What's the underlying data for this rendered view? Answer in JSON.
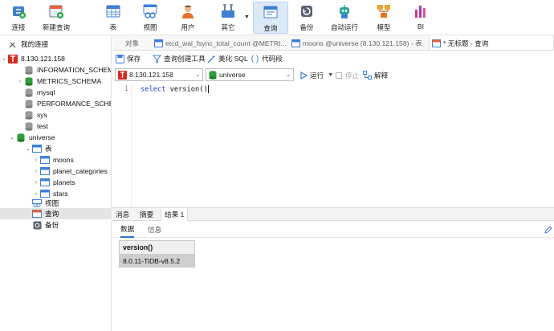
{
  "toolbar": {
    "connect": "连接",
    "new_query": "新建查询",
    "table": "表",
    "view": "视图",
    "user": "用户",
    "other": "其它",
    "query": "查询",
    "backup": "备份",
    "automation": "自动运行",
    "model": "模型",
    "bi": "BI"
  },
  "sidebar": {
    "my_connections": "我的连接",
    "connection": "8.130.121.158",
    "databases": [
      "INFORMATION_SCHEMA",
      "METRICS_SCHEMA",
      "mysql",
      "PERFORMANCE_SCHEMA",
      "sys",
      "test"
    ],
    "active_db": "universe",
    "tables_folder": "表",
    "tables": [
      "moons",
      "planet_categories",
      "planets",
      "stars"
    ],
    "views": "视图",
    "queries": "查询",
    "backups": "备份"
  },
  "tabs": {
    "objects": "对象",
    "tab1": "etcd_wal_fsync_total_count @METRI...",
    "tab2": "moons @universe (8.130.121.158) - 表",
    "tab3": "* 无标题 - 查询"
  },
  "query_toolbar": {
    "save": "保存",
    "builder": "查询创建工具",
    "beautify": "美化 SQL",
    "snippet": "代码段"
  },
  "connbar": {
    "connection": "8.130.121.158",
    "database": "universe",
    "run": "运行",
    "stop": "停止",
    "explain": "解释"
  },
  "editor": {
    "line_number": "1",
    "keyword": "select",
    "rest": " version()"
  },
  "results": {
    "tabs": [
      "消息",
      "摘要",
      "结果 1"
    ],
    "subtabs": [
      "数据",
      "信息"
    ],
    "column": "version()",
    "value": "8.0.11-TiDB-v8.5.2"
  },
  "colors": {
    "accent": "#2f6fd0",
    "highlight": "#dce9f7",
    "db_green": "#2e9d3a",
    "conn_red": "#d52b1e"
  }
}
